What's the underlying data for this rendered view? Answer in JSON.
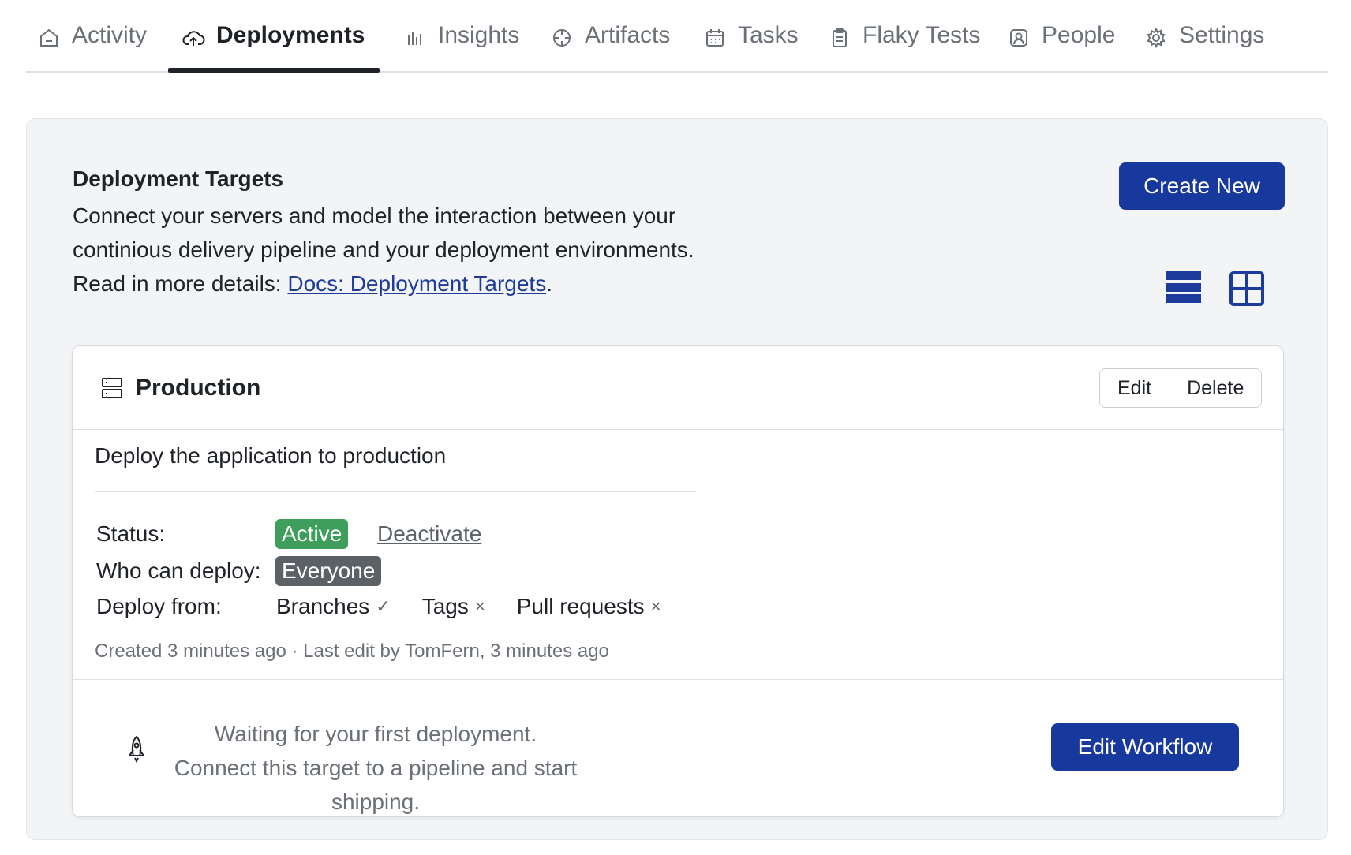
{
  "tabs": [
    {
      "label": "Activity",
      "icon": "home-icon"
    },
    {
      "label": "Deployments",
      "icon": "cloud-upload-icon",
      "active": true
    },
    {
      "label": "Insights",
      "icon": "bar-chart-icon"
    },
    {
      "label": "Artifacts",
      "icon": "artifact-icon"
    },
    {
      "label": "Tasks",
      "icon": "calendar-icon"
    },
    {
      "label": "Flaky Tests",
      "icon": "clipboard-icon"
    },
    {
      "label": "People",
      "icon": "person-icon"
    },
    {
      "label": "Settings",
      "icon": "gear-icon"
    }
  ],
  "header": {
    "title": "Deployment Targets",
    "desc_line1": "Connect your servers and model the interaction between your",
    "desc_line2": "continious delivery pipeline and your deployment environments.",
    "read_more": "Read in more details: ",
    "docs_link": "Docs: Deployment Targets",
    "period": ".",
    "create_label": "Create New"
  },
  "colors": {
    "primary": "#17389c",
    "active_badge": "#3f9e5b",
    "everyone_badge": "#5c6166"
  },
  "target": {
    "name": "Production",
    "edit_label": "Edit",
    "delete_label": "Delete",
    "description": "Deploy the application to production",
    "status_label": "Status:",
    "status_value": "Active",
    "deactivate_label": "Deactivate",
    "who_label": "Who can deploy:",
    "who_value": "Everyone",
    "from_label": "Deploy from:",
    "from": [
      {
        "label": "Branches",
        "mark": "✓"
      },
      {
        "label": "Tags",
        "mark": "×"
      },
      {
        "label": "Pull requests",
        "mark": "×"
      }
    ],
    "meta": "Created 3 minutes ago · Last edit by TomFern, 3 minutes ago",
    "waiting_line1": "Waiting for your first deployment.",
    "waiting_line2": "Connect this target to a pipeline and start shipping.",
    "workflow_label": "Edit Workflow"
  }
}
